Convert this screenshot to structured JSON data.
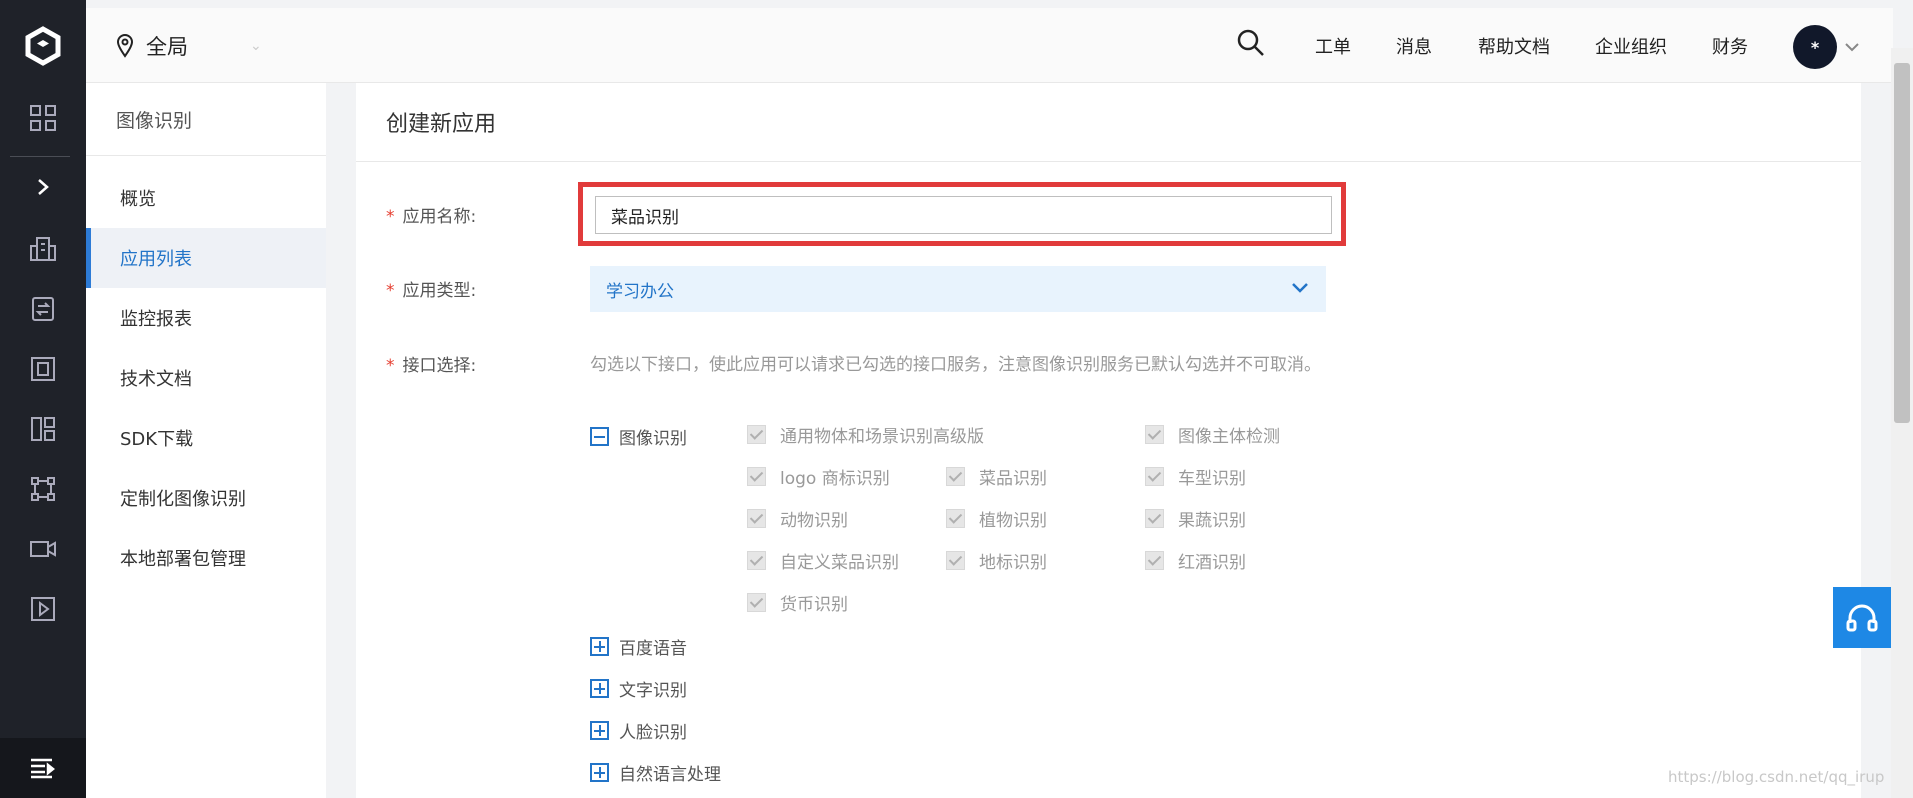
{
  "topbar": {
    "region": "全局",
    "nav": [
      "工单",
      "消息",
      "帮助文档",
      "企业组织",
      "财务"
    ],
    "avatar_text": "*"
  },
  "sidebar": {
    "title": "图像识别",
    "items": [
      "概览",
      "应用列表",
      "监控报表",
      "技术文档",
      "SDK下载",
      "定制化图像识别",
      "本地部署包管理"
    ],
    "active_index": 1
  },
  "form": {
    "title": "创建新应用",
    "name_label": "应用名称:",
    "name_value": "菜品识别",
    "type_label": "应用类型:",
    "type_value": "学习办公",
    "api_label": "接口选择:",
    "api_hint": "勾选以下接口，使此应用可以请求已勾选的接口服务，注意图像识别服务已默认勾选并不可取消。",
    "required_mark": "*",
    "expanded_group": "图像识别",
    "apis": [
      "通用物体和场景识别高级版",
      "图像主体检测",
      "logo 商标识别",
      "菜品识别",
      "车型识别",
      "动物识别",
      "植物识别",
      "果蔬识别",
      "自定义菜品识别",
      "地标识别",
      "红酒识别",
      "货币识别"
    ],
    "collapsed_groups": [
      "百度语音",
      "文字识别",
      "人脸识别",
      "自然语言处理"
    ]
  },
  "watermark": "https://blog.csdn.net/qq_irup",
  "colors": {
    "accent": "#2274c8",
    "highlight_box": "#e13b3b",
    "rail_bg": "#1f2229"
  }
}
